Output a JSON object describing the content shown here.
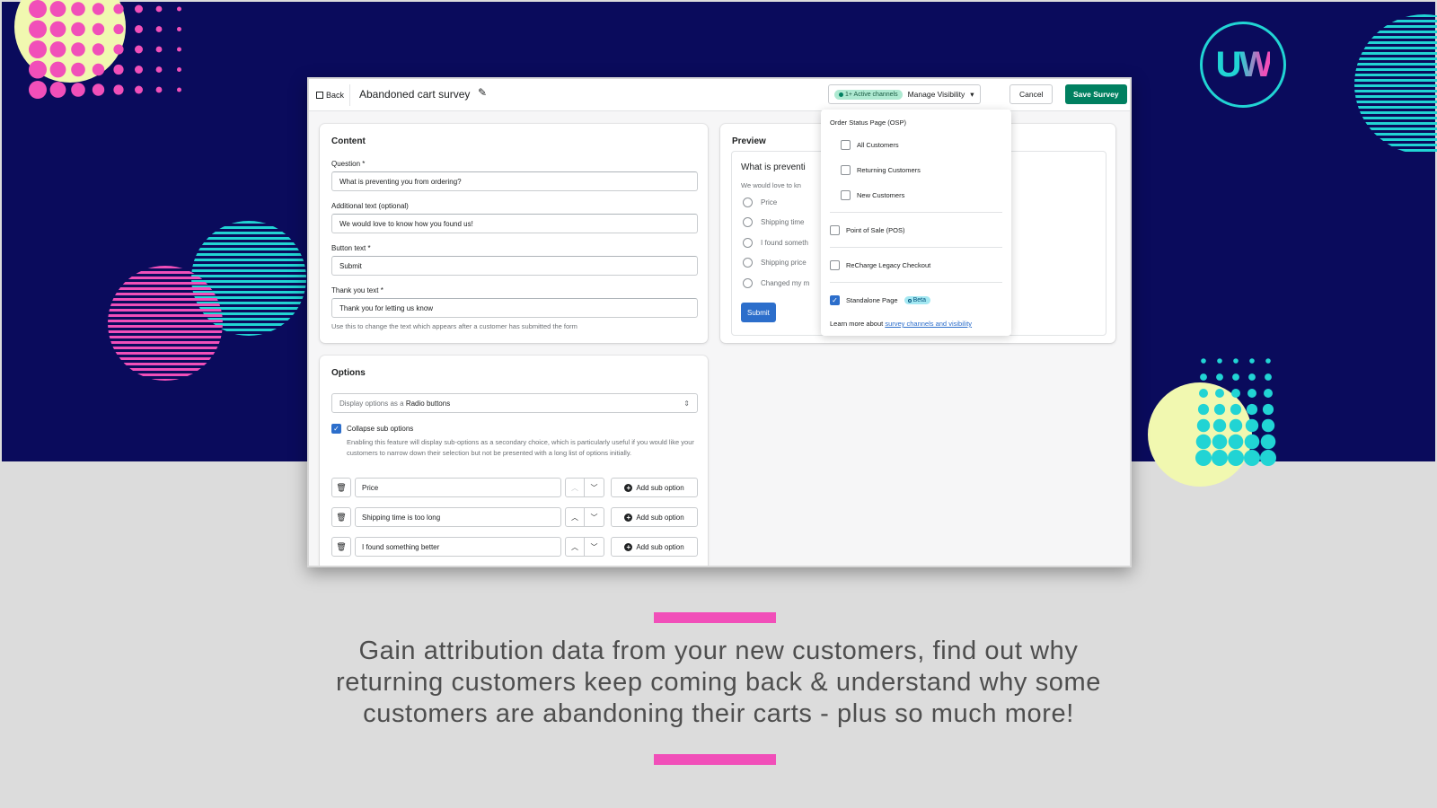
{
  "colors": {
    "navy": "#0a0b5c",
    "grey_bg": "#dcdcdc",
    "pink": "#f14fb9",
    "cyan": "#21d4d4",
    "yellow": "#f1f8b0",
    "shopify_green": "#008060",
    "link_blue": "#2c6ecb"
  },
  "logo": {
    "text_u": "U",
    "text_w": "W"
  },
  "app": {
    "topbar": {
      "back_label": "Back",
      "title": "Abandoned cart survey",
      "channels_badge": "1+ Active channels",
      "manage_visibility": "Manage Visibility",
      "cancel": "Cancel",
      "save": "Save Survey"
    },
    "content": {
      "title": "Content",
      "question_label": "Question *",
      "question_value": "What is preventing you from ordering?",
      "additional_label": "Additional text (optional)",
      "additional_value": "We would love to know how you found us!",
      "button_label": "Button text *",
      "button_value": "Submit",
      "thankyou_label": "Thank you text *",
      "thankyou_value": "Thank you for letting us know",
      "thankyou_help": "Use this to change the text which appears after a customer has submitted the form"
    },
    "options": {
      "title": "Options",
      "display_prefix": "Display options as a",
      "display_value": "Radio buttons",
      "collapse_label": "Collapse sub options",
      "collapse_checked": true,
      "collapse_help": "Enabling this feature will display sub-options as a secondary choice, which is particularly useful if you would like your customers to narrow down their selection but not be presented with a long list of options initially.",
      "add_sub_option": "Add sub option",
      "rows": [
        {
          "value": "Price"
        },
        {
          "value": "Shipping time is too long"
        },
        {
          "value": "I found something better"
        }
      ]
    },
    "preview": {
      "title": "Preview",
      "question": "What is preventi",
      "subtext": "We would love to kn",
      "options": [
        "Price",
        "Shipping time",
        "I found someth",
        "Shipping price",
        "Changed my m"
      ],
      "submit": "Submit"
    },
    "visibility": {
      "osp_title": "Order Status Page (OSP)",
      "all_customers": "All Customers",
      "returning_customers": "Returning Customers",
      "new_customers": "New Customers",
      "pos": "Point of Sale (POS)",
      "recharge": "ReCharge Legacy Checkout",
      "standalone": "Standalone Page",
      "beta": "Beta",
      "standalone_checked": true,
      "learn_more_prefix": "Learn more about",
      "learn_more_link": "survey channels and visibility"
    }
  },
  "tagline": {
    "line1": "Gain attribution data from your new customers, find out why",
    "line2": "returning customers keep coming back & understand why some",
    "line3": "customers are abandoning their carts - plus so much more!"
  }
}
